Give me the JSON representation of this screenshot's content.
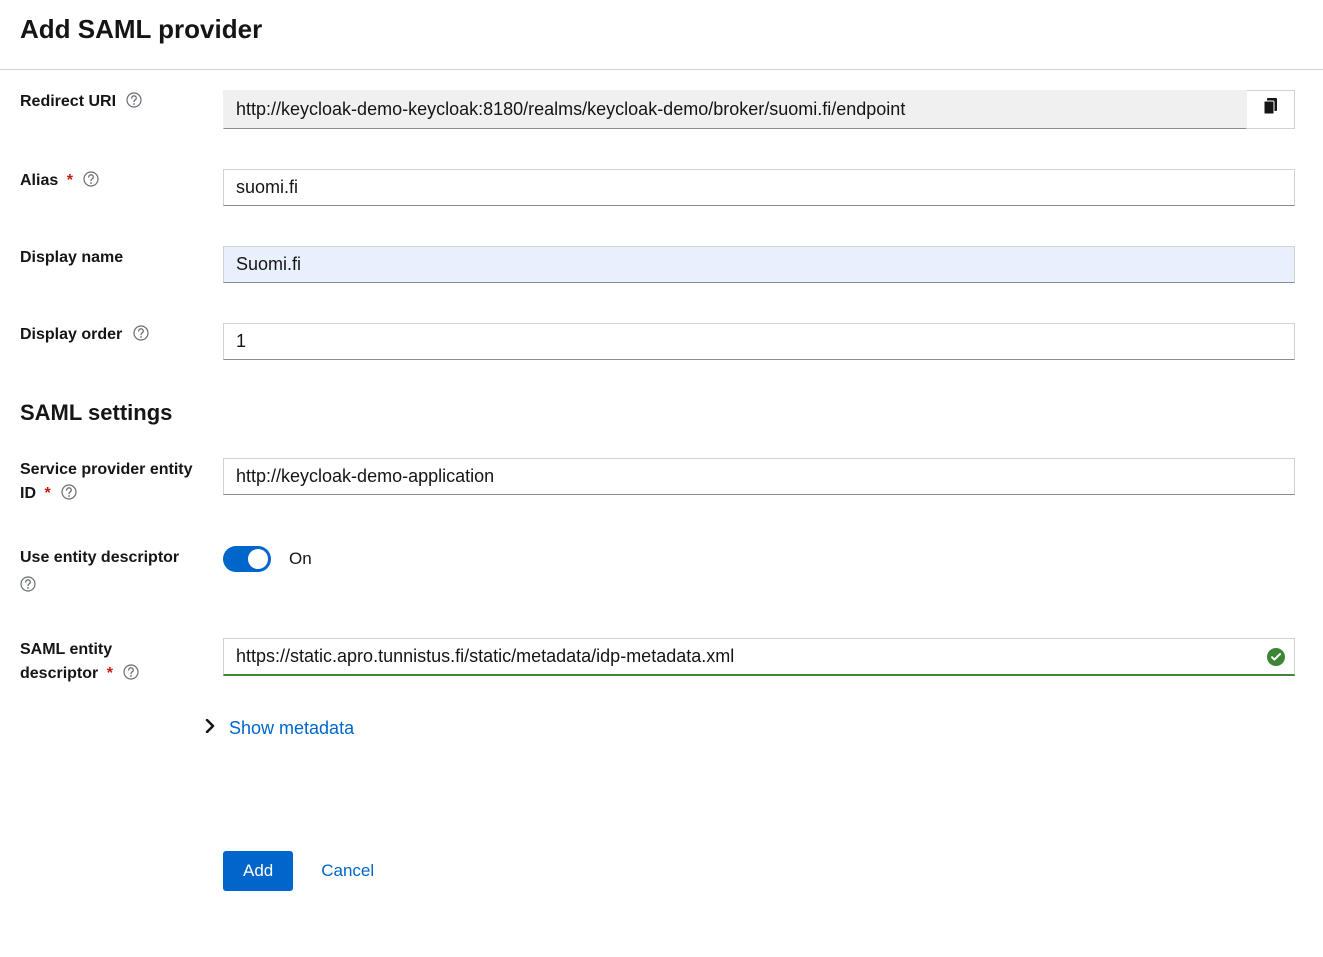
{
  "page": {
    "title": "Add SAML provider"
  },
  "sections": {
    "saml_settings": "SAML settings"
  },
  "labels": {
    "redirect_uri": "Redirect URI",
    "alias": "Alias",
    "display_name": "Display name",
    "display_order": "Display order",
    "sp_entity_id_l1": "Service provider entity",
    "sp_entity_id_l2": "ID",
    "use_entity_desc": "Use entity descriptor",
    "saml_entity_desc_l1": "SAML entity",
    "saml_entity_desc_l2": "descriptor"
  },
  "values": {
    "redirect_uri": "http://keycloak-demo-keycloak:8180/realms/keycloak-demo/broker/suomi.fi/endpoint",
    "alias": "suomi.fi",
    "display_name": "Suomi.fi",
    "display_order": "1",
    "sp_entity_id": "http://keycloak-demo-application",
    "saml_entity_descriptor": "https://static.apro.tunnistus.fi/static/metadata/idp-metadata.xml"
  },
  "toggle": {
    "use_entity_desc": {
      "on": true,
      "label": "On"
    }
  },
  "links": {
    "show_metadata": "Show metadata"
  },
  "buttons": {
    "add": "Add",
    "cancel": "Cancel"
  },
  "colors": {
    "primary": "#0066cc",
    "success": "#3e8635",
    "danger": "#c9190b"
  }
}
